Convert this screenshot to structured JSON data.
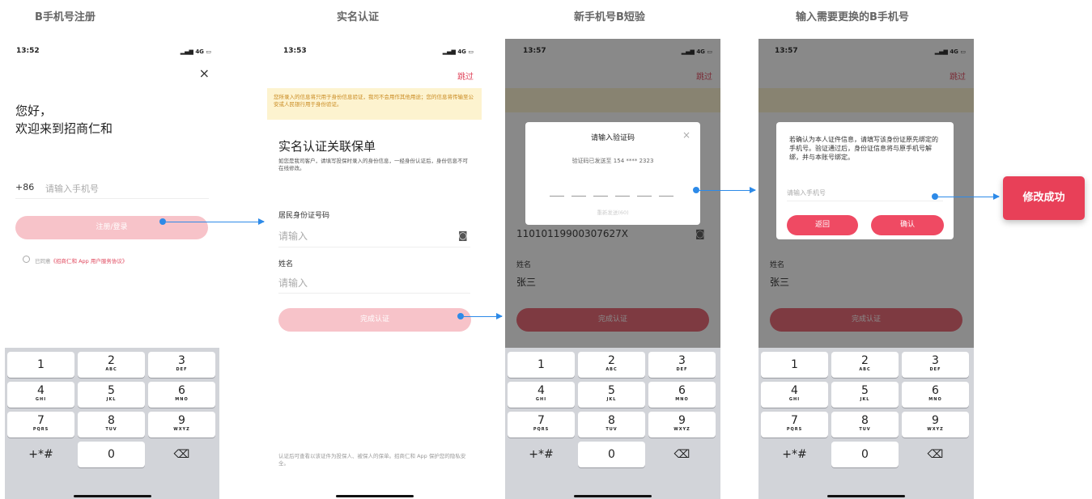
{
  "titles": [
    "B手机号注册",
    "实名认证",
    "新手机号B短验",
    "输入需要更换的B手机号"
  ],
  "status": [
    {
      "time": "13:52",
      "signal": "4G"
    },
    {
      "time": "13:53",
      "signal": "4G"
    },
    {
      "time": "13:57",
      "signal": "4G"
    },
    {
      "time": "13:57",
      "signal": "4G"
    }
  ],
  "screen1": {
    "close": "×",
    "greeting": "您好，",
    "welcome": "欢迎来到招商仁和",
    "country_code": "+86",
    "phone_placeholder": "请输入手机号",
    "login_button": "注册/登录",
    "agree_prefix": "已同意",
    "agree_link": "《招商仁和 App 用户服务协议》"
  },
  "screen2": {
    "skip": "跳过",
    "banner": "您所录入的信息将只用于身份信息验证，我司不会用作其他用途；您的信息将传输至公安或人民银行用于身份验证。",
    "heading": "实名认证关联保单",
    "desc": "如您是我司客户，请填写投保时录入的身份信息，一经身份认证后，身份信息不可在线修改。",
    "id_label": "居民身份证号码",
    "id_placeholder": "请输入",
    "name_label": "姓名",
    "name_placeholder": "请输入",
    "submit": "完成认证",
    "footer": "认证后可查看以该证件为投保人、被保人的保单。招商仁和 App 保护您的隐私安全。"
  },
  "screen3": {
    "skip": "跳过",
    "id_value": "11010119900307627X",
    "name_label": "姓名",
    "name_value": "张三",
    "submit": "完成认证",
    "dialog_title": "请输入验证码",
    "dialog_close": "×",
    "sent_text": "验证码已发送至 154 **** 2323",
    "resend": "重新发送(60)"
  },
  "screen4": {
    "skip": "跳过",
    "name_label": "姓名",
    "name_value": "张三",
    "submit": "完成认证",
    "dialog_text": "若确认为本人证件信息，请填写该身份证原先绑定的手机号。验证通过后，身份证信息将与原手机号解绑，并与本账号绑定。",
    "phone_placeholder": "请输入手机号",
    "back": "返回",
    "confirm": "确认"
  },
  "success": "修改成功",
  "keyboard": {
    "keys": [
      {
        "n": "1",
        "l": ""
      },
      {
        "n": "2",
        "l": "ABC"
      },
      {
        "n": "3",
        "l": "DEF"
      },
      {
        "n": "4",
        "l": "GHI"
      },
      {
        "n": "5",
        "l": "JKL"
      },
      {
        "n": "6",
        "l": "MNO"
      },
      {
        "n": "7",
        "l": "PQRS"
      },
      {
        "n": "8",
        "l": "TUV"
      },
      {
        "n": "9",
        "l": "WXYZ"
      }
    ],
    "symbols": "+*#",
    "zero": "0",
    "delete": "⌫"
  },
  "colors": {
    "accent": "#ef4a63",
    "accent_light": "#f7b8c0",
    "arrow": "#2d8ae8",
    "banner": "#fdf3cf"
  }
}
